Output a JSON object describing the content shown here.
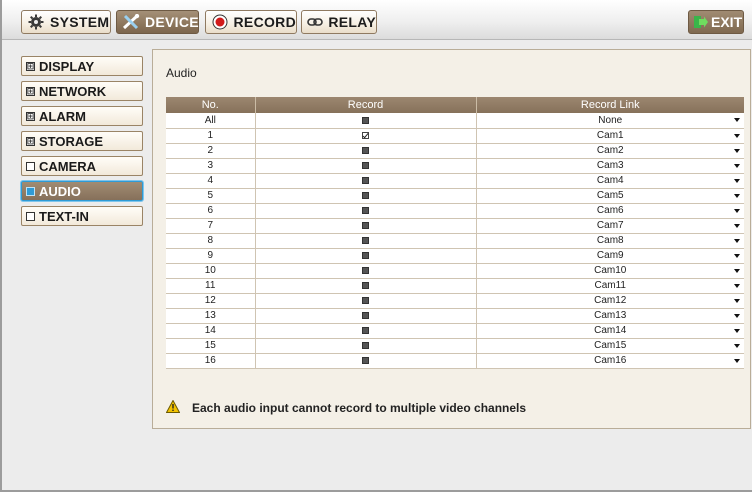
{
  "tabs": [
    {
      "label": "SYSTEM",
      "icon": "gear-icon"
    },
    {
      "label": "DEVICE",
      "icon": "tools-icon"
    },
    {
      "label": "RECORD",
      "icon": "record-icon"
    },
    {
      "label": "RELAY",
      "icon": "relay-link-icon"
    }
  ],
  "active_tab": "DEVICE",
  "exit_label": "EXIT",
  "sidebar": [
    {
      "label": "DISPLAY",
      "marker": "⊞"
    },
    {
      "label": "NETWORK",
      "marker": "⊞"
    },
    {
      "label": "ALARM",
      "marker": "⊞"
    },
    {
      "label": "STORAGE",
      "marker": "⊞"
    },
    {
      "label": "CAMERA",
      "marker": ""
    },
    {
      "label": "AUDIO",
      "marker": ""
    },
    {
      "label": "TEXT-IN",
      "marker": ""
    }
  ],
  "active_menu": "AUDIO",
  "panel": {
    "title": "Audio",
    "columns": [
      "No.",
      "Record",
      "Record Link"
    ],
    "rows": [
      {
        "no": "All",
        "record": false,
        "link": "None"
      },
      {
        "no": "1",
        "record": true,
        "link": "Cam1"
      },
      {
        "no": "2",
        "record": false,
        "link": "Cam2"
      },
      {
        "no": "3",
        "record": false,
        "link": "Cam3"
      },
      {
        "no": "4",
        "record": false,
        "link": "Cam4"
      },
      {
        "no": "5",
        "record": false,
        "link": "Cam5"
      },
      {
        "no": "6",
        "record": false,
        "link": "Cam6"
      },
      {
        "no": "7",
        "record": false,
        "link": "Cam7"
      },
      {
        "no": "8",
        "record": false,
        "link": "Cam8"
      },
      {
        "no": "9",
        "record": false,
        "link": "Cam9"
      },
      {
        "no": "10",
        "record": false,
        "link": "Cam10"
      },
      {
        "no": "11",
        "record": false,
        "link": "Cam11"
      },
      {
        "no": "12",
        "record": false,
        "link": "Cam12"
      },
      {
        "no": "13",
        "record": false,
        "link": "Cam13"
      },
      {
        "no": "14",
        "record": false,
        "link": "Cam14"
      },
      {
        "no": "15",
        "record": false,
        "link": "Cam15"
      },
      {
        "no": "16",
        "record": false,
        "link": "Cam16"
      }
    ],
    "note": "Each audio input cannot record to multiple video channels"
  },
  "colors": {
    "accent_brown": "#8d765c",
    "selection_blue": "#2f9bd6",
    "warning_yellow": "#f2c200"
  }
}
